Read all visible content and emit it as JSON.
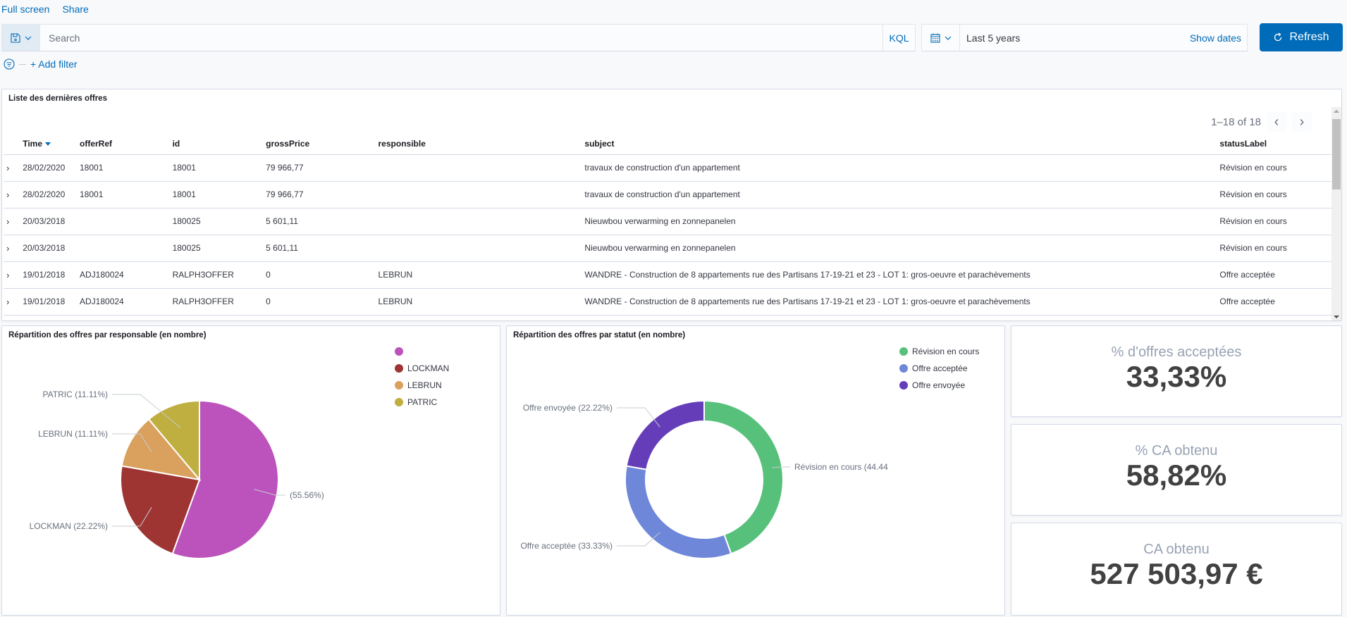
{
  "topnav": {
    "fullscreen": "Full screen",
    "share": "Share"
  },
  "querybar": {
    "placeholder": "Search",
    "language": "KQL",
    "save_icon": "save-icon",
    "chevron_icon": "chevron-down-icon"
  },
  "datepicker": {
    "range": "Last 5 years",
    "show_dates": "Show dates",
    "calendar_icon": "calendar-icon"
  },
  "refresh": {
    "label": "Refresh",
    "icon": "refresh-icon"
  },
  "filters": {
    "add_filter": "+ Add filter",
    "filter_icon": "filter-icon"
  },
  "offers_table": {
    "title": "Liste des dernières offres",
    "pagination": "1–18 of 18",
    "columns": [
      "Time",
      "offerRef",
      "id",
      "grossPrice",
      "responsible",
      "subject",
      "statusLabel"
    ],
    "rows": [
      [
        "28/02/2020",
        "18001",
        "18001",
        "79 966,77",
        "",
        "travaux de construction d'un appartement",
        "Révision en cours"
      ],
      [
        "28/02/2020",
        "18001",
        "18001",
        "79 966,77",
        "",
        "travaux de construction d'un appartement",
        "Révision en cours"
      ],
      [
        "20/03/2018",
        "",
        "180025",
        "5 601,11",
        "",
        "Nieuwbou verwarming en zonnepanelen",
        "Révision en cours"
      ],
      [
        "20/03/2018",
        "",
        "180025",
        "5 601,11",
        "",
        "Nieuwbou verwarming en zonnepanelen",
        "Révision en cours"
      ],
      [
        "19/01/2018",
        "ADJ180024",
        "RALPH3OFFER",
        "0",
        "LEBRUN",
        "WANDRE - Construction de 8 appartements rue des Partisans 17-19-21 et 23 - LOT 1: gros-oeuvre et parachèvements",
        "Offre acceptée"
      ],
      [
        "19/01/2018",
        "ADJ180024",
        "RALPH3OFFER",
        "0",
        "LEBRUN",
        "WANDRE - Construction de 8 appartements rue des Partisans 17-19-21 et 23 - LOT 1: gros-oeuvre et parachèvements",
        "Offre acceptée"
      ]
    ]
  },
  "chart_data": [
    {
      "type": "pie",
      "title": "Répartition des offres par responsable (en nombre)",
      "categories": [
        "",
        "LOCKMAN",
        "LEBRUN",
        "PATRIC"
      ],
      "values": [
        55.56,
        22.22,
        11.11,
        11.11
      ],
      "labels": [
        "(55.56%)",
        "LOCKMAN (22.22%)",
        "LEBRUN (11.11%)",
        "PATRIC (11.11%)"
      ],
      "colors": [
        "#bc52bc",
        "#9e3533",
        "#daa05d",
        "#bfaf40"
      ],
      "donut": false,
      "legend": "top-right"
    },
    {
      "type": "pie",
      "title": "Répartition des offres par statut (en nombre)",
      "categories": [
        "Révision en cours",
        "Offre acceptée",
        "Offre envoyée"
      ],
      "values": [
        44.44,
        33.33,
        22.22
      ],
      "labels": [
        "Révision en cours (44.44",
        "Offre acceptée (33.33%)",
        "Offre envoyée (22.22%)"
      ],
      "colors": [
        "#57c17b",
        "#6f87d8",
        "#663db8"
      ],
      "donut": true,
      "legend": "top-right"
    }
  ],
  "metrics": [
    {
      "label": "% d'offres acceptées",
      "value": "33,33%"
    },
    {
      "label": "% CA obtenu",
      "value": "58,82%"
    },
    {
      "label": "CA obtenu",
      "value": "527 503,97 €"
    }
  ]
}
